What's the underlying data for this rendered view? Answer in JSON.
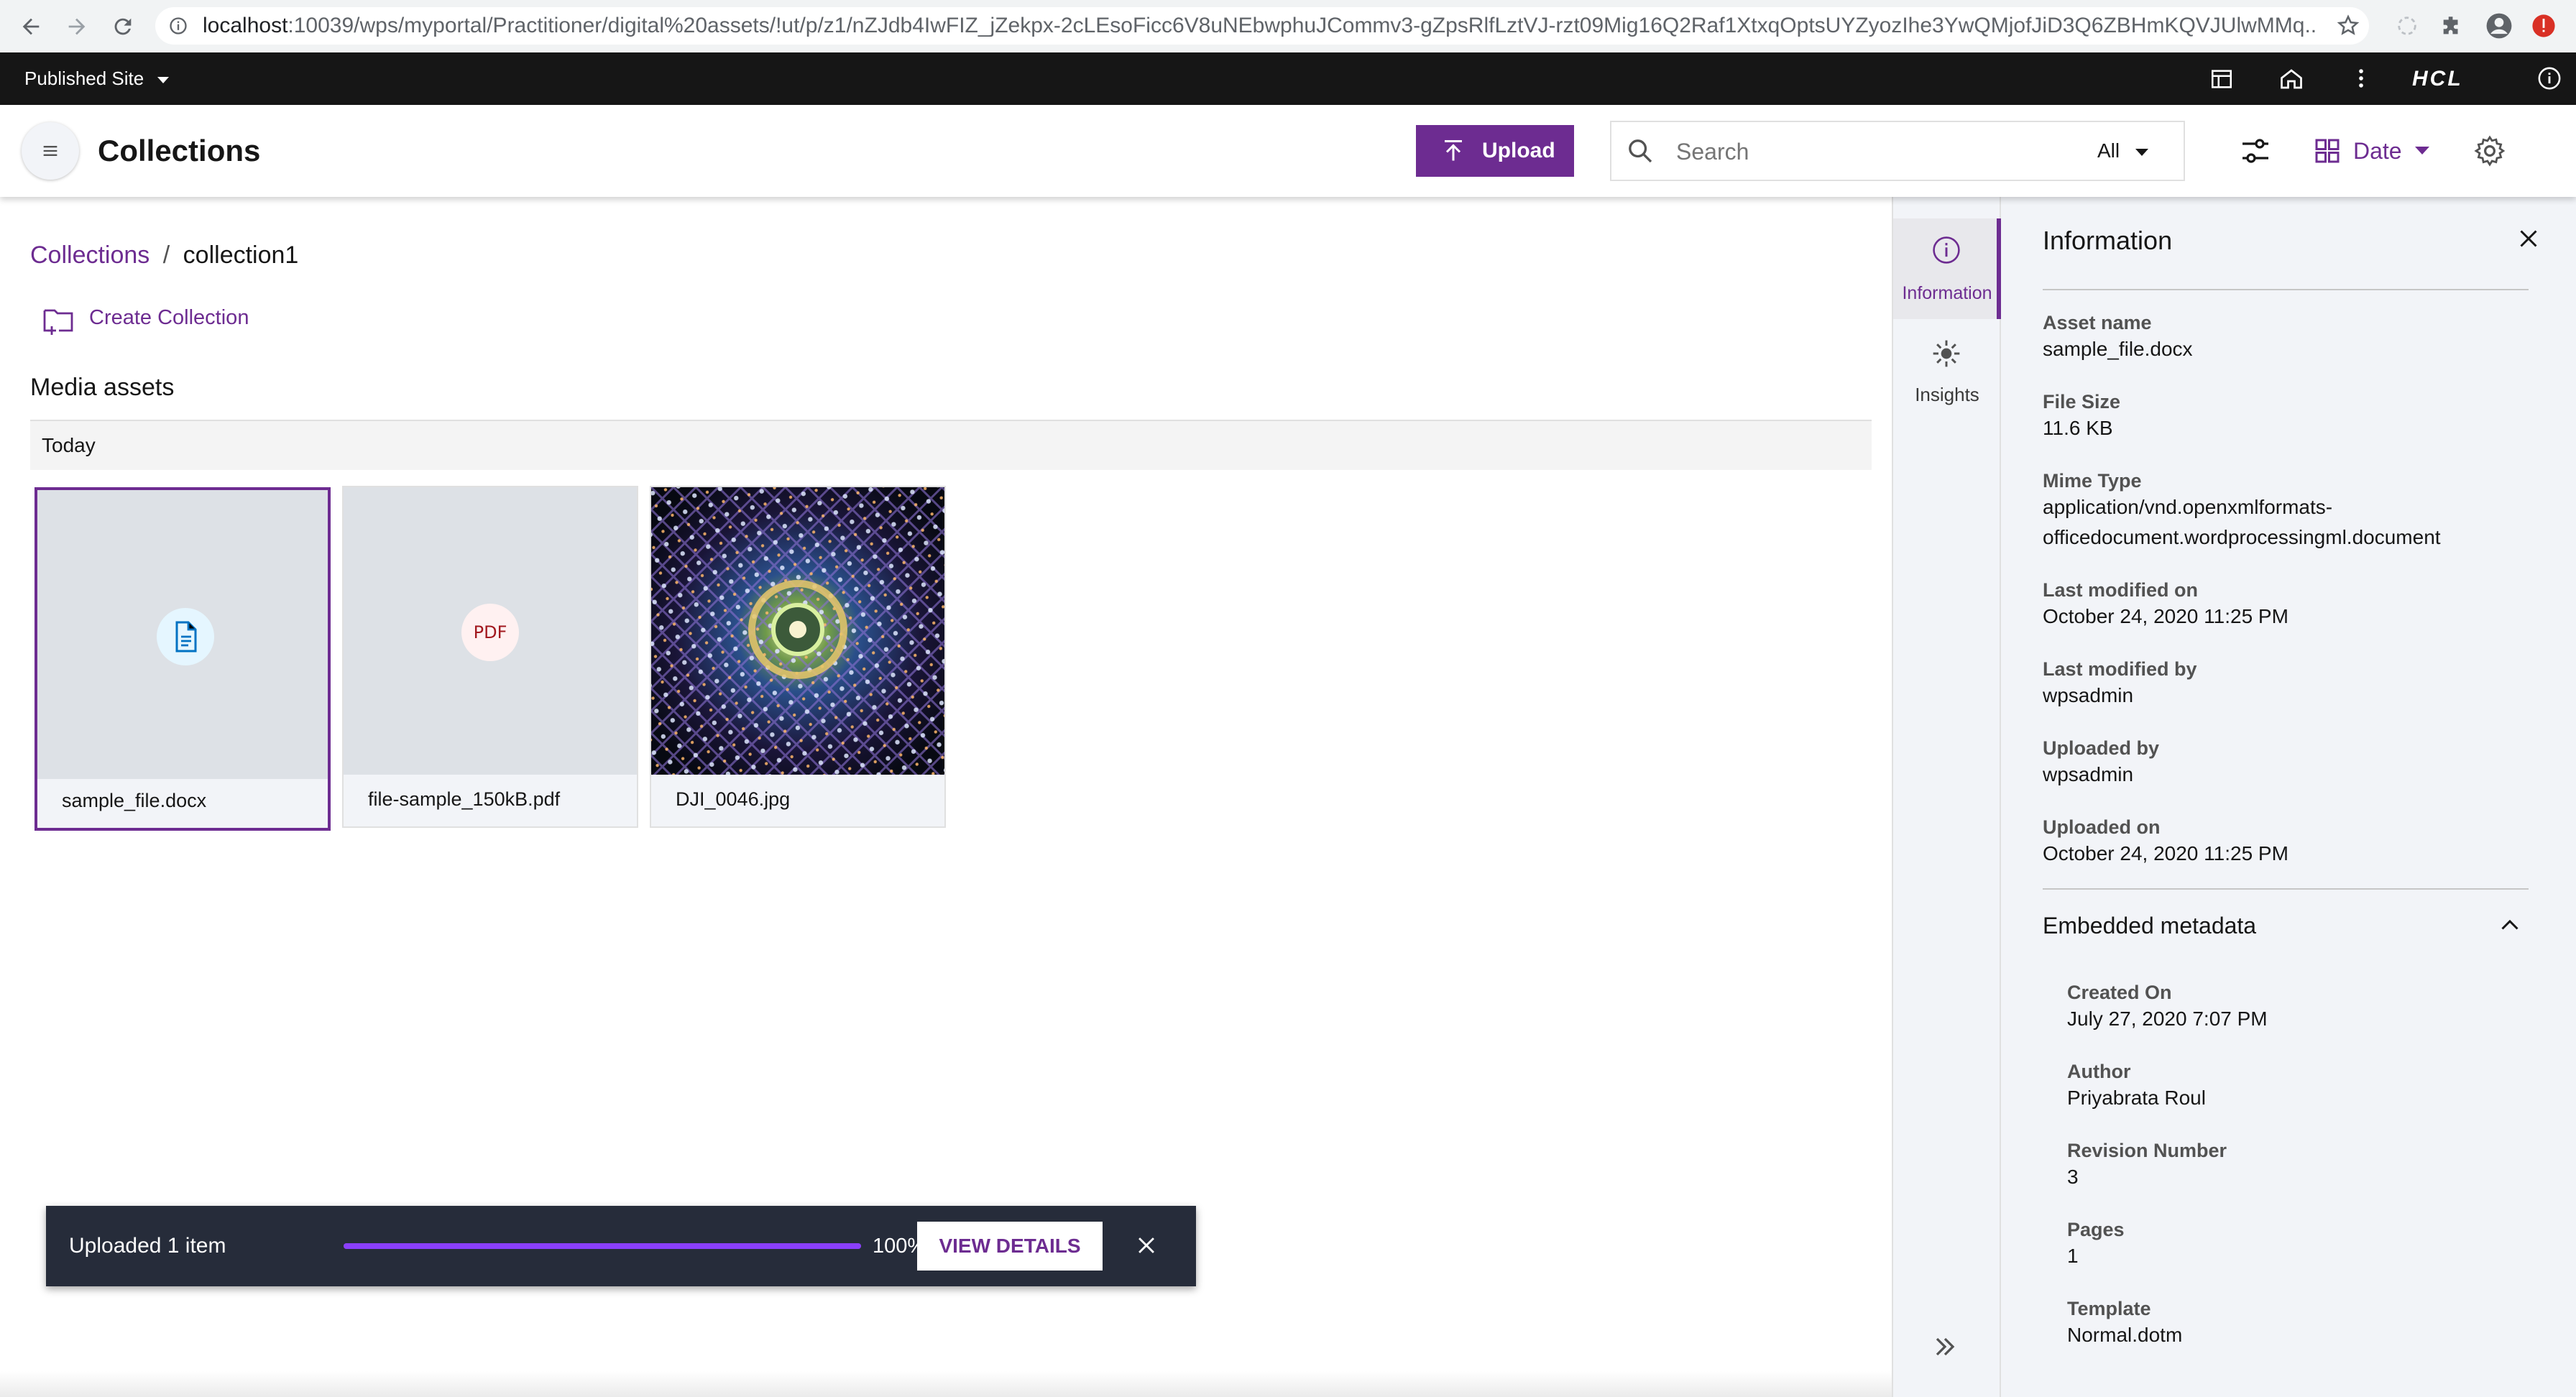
{
  "browser": {
    "url_prefix": "localhost",
    "url_rest": ":10039/wps/myportal/Practitioner/digital%20assets/!ut/p/z1/nZJdb4IwFIZ_jZekpx-2cLEsoFicc6V8uNEbwphuJCommv3-gZpsRlfLztVJ-rzt09Mig16Q2Raf1XtxqOptsUYZyozIhe3YwQMjofJiD3Q6ZBHmKQVJUlwMMq..."
  },
  "portal_bar": {
    "site_label": "Published Site",
    "brand": "HCL"
  },
  "header": {
    "title": "Collections",
    "upload_label": "Upload",
    "search_placeholder": "Search",
    "search_scope": "All",
    "sort_label": "Date"
  },
  "breadcrumb": {
    "root": "Collections",
    "separator": "/",
    "current": "collection1"
  },
  "create_collection_label": "Create Collection",
  "media_section_title": "Media assets",
  "group_label": "Today",
  "assets": [
    {
      "name": "sample_file.docx",
      "type": "doc-icon",
      "selected": true
    },
    {
      "name": "file-sample_150kB.pdf",
      "type": "pdf-icon",
      "badge": "PDF"
    },
    {
      "name": "DJI_0046.jpg",
      "type": "image"
    }
  ],
  "rail": {
    "info_label": "Information",
    "insights_label": "Insights"
  },
  "info": {
    "title": "Information",
    "fields": [
      {
        "label": "Asset name",
        "value": "sample_file.docx"
      },
      {
        "label": "File Size",
        "value": "11.6 KB"
      },
      {
        "label": "Mime Type",
        "value": "application/vnd.openxmlformats-",
        "value2": "officedocument.wordprocessingml.document"
      },
      {
        "label": "Last modified on",
        "value": "October 24, 2020 11:25 PM"
      },
      {
        "label": "Last modified by",
        "value": "wpsadmin"
      },
      {
        "label": "Uploaded by",
        "value": "wpsadmin"
      },
      {
        "label": "Uploaded on",
        "value": "October 24, 2020 11:25 PM"
      }
    ],
    "embedded_title": "Embedded metadata",
    "embedded": [
      {
        "label": "Created On",
        "value": "July 27, 2020 7:07 PM"
      },
      {
        "label": "Author",
        "value": "Priyabrata Roul"
      },
      {
        "label": "Revision Number",
        "value": "3"
      },
      {
        "label": "Pages",
        "value": "1"
      },
      {
        "label": "Template",
        "value": "Normal.dotm"
      }
    ]
  },
  "toast": {
    "message": "Uploaded 1 item",
    "progress": 1.0,
    "progress_text": "100%",
    "details_label": "VIEW DETAILS"
  },
  "colors": {
    "accent": "#6d2c91",
    "toast_bg": "#262c3a",
    "toolbar_bg": "#161616"
  }
}
